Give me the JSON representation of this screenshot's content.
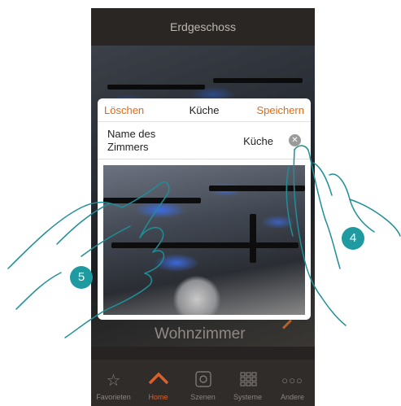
{
  "header": {
    "title": "Erdgeschoss"
  },
  "room": {
    "name": "Wohnzimmer"
  },
  "dialog": {
    "delete_label": "Löschen",
    "title": "Küche",
    "save_label": "Speichern",
    "field_label": "Name des Zimmers",
    "field_value": "Küche"
  },
  "tabs": [
    {
      "label": "Favorieten",
      "icon": "star-icon",
      "active": false
    },
    {
      "label": "Home",
      "icon": "home-icon",
      "active": true
    },
    {
      "label": "Szenen",
      "icon": "scenes-icon",
      "active": false
    },
    {
      "label": "Systeme",
      "icon": "grid-icon",
      "active": false
    },
    {
      "label": "Andere",
      "icon": "more-icon",
      "active": false
    }
  ],
  "callouts": {
    "left": "5",
    "right": "4"
  },
  "colors": {
    "accent": "#e06a10",
    "callout": "#1e9aa0",
    "background": "#262322"
  }
}
